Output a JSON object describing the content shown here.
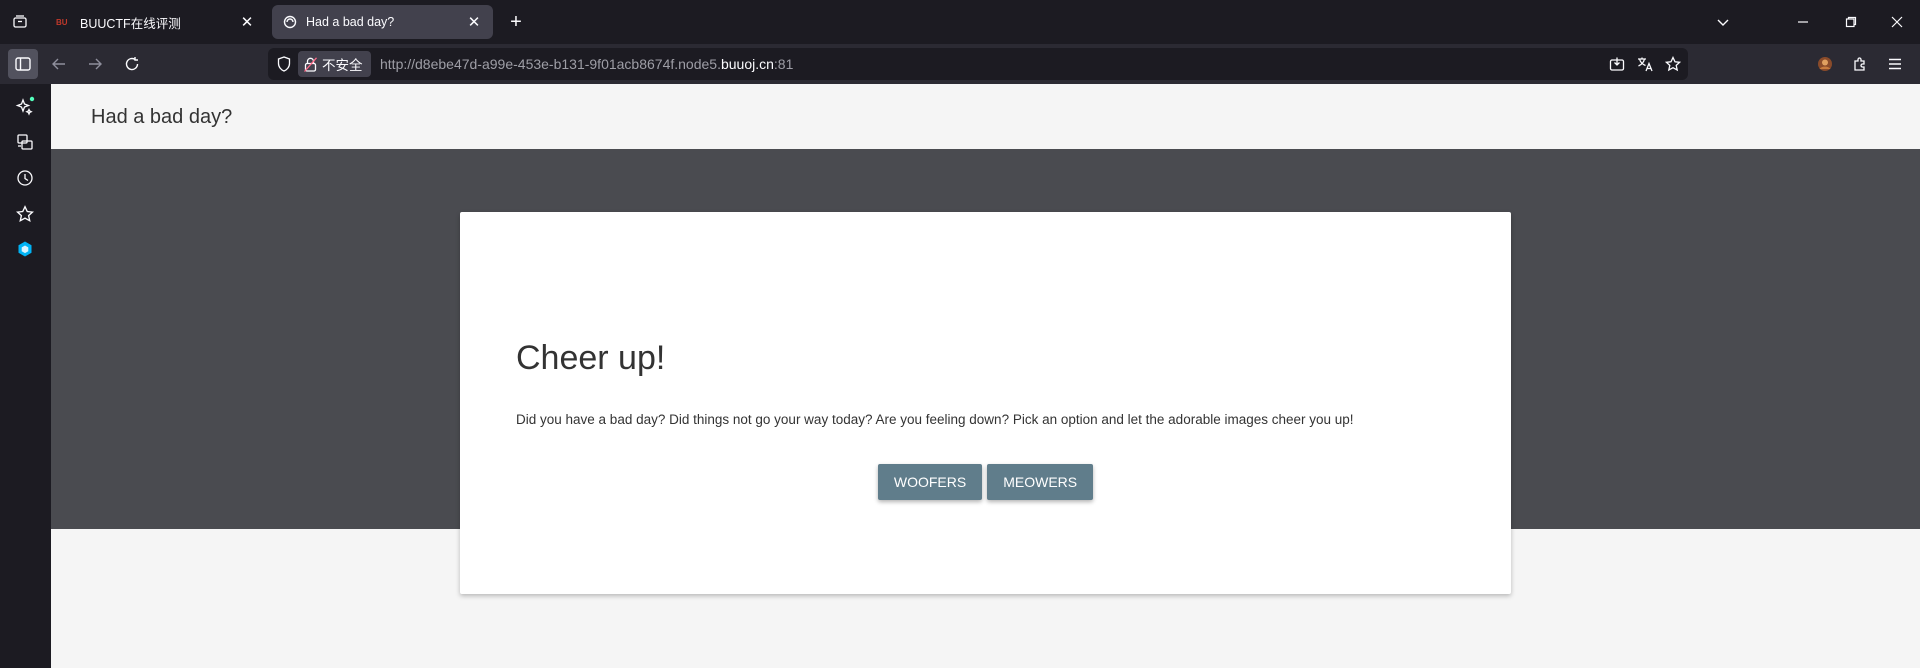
{
  "tabs": [
    {
      "title": "BUUCTF在线评测",
      "active": false
    },
    {
      "title": "Had a bad day?",
      "active": true
    }
  ],
  "urlbar": {
    "security_label": "不安全",
    "url_prefix": "http://d8ebe47d-a99e-453e-b131-9f01acb8674f.node5.",
    "url_host": "buuoj.cn",
    "url_suffix": ":81"
  },
  "page": {
    "site_title": "Had a bad day?",
    "heading": "Cheer up!",
    "description": "Did you have a bad day? Did things not go your way today? Are you feeling down? Pick an option and let the adorable images cheer you up!",
    "buttons": {
      "woofers": "WOOFERS",
      "meowers": "MEOWERS"
    }
  },
  "colors": {
    "hero_background": "#4a4b50",
    "button": "#607d8b",
    "sidebar_dot": "#54ffbd",
    "accent_cube": "#00b3f4"
  },
  "icons": {
    "tab_list": "tab-list-icon",
    "new_tab": "plus-icon",
    "sidebar": [
      "sparkle-ai-icon",
      "synced-tabs-icon",
      "history-icon",
      "bookmark-star-icon",
      "extension-cube-icon"
    ]
  }
}
